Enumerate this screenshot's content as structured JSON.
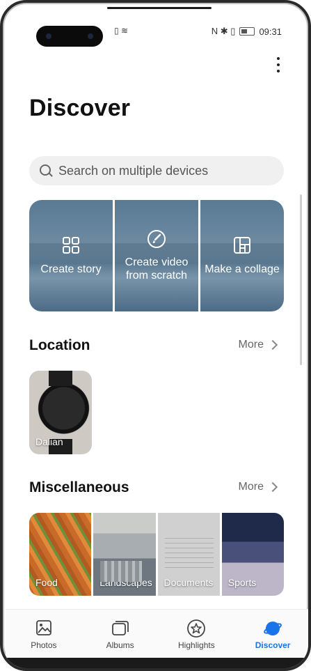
{
  "status": {
    "time": "09:31",
    "left_icons": "▯ ≋",
    "right_icons": "N ✱ ▯"
  },
  "page": {
    "title": "Discover"
  },
  "search": {
    "placeholder": "Search on multiple devices"
  },
  "create": {
    "story": "Create story",
    "video": "Create video from scratch",
    "collage": "Make a collage"
  },
  "location": {
    "title": "Location",
    "more": "More",
    "cards": [
      {
        "label": "Dalian"
      }
    ]
  },
  "misc": {
    "title": "Miscellaneous",
    "more": "More",
    "cards": [
      {
        "label": "Food"
      },
      {
        "label": "Landscapes"
      },
      {
        "label": "Documents"
      },
      {
        "label": "Sports"
      }
    ]
  },
  "nav": {
    "items": [
      {
        "label": "Photos",
        "icon": "photo-icon"
      },
      {
        "label": "Albums",
        "icon": "albums-icon"
      },
      {
        "label": "Highlights",
        "icon": "star-icon"
      },
      {
        "label": "Discover",
        "icon": "planet-icon"
      }
    ],
    "active_color": "#1a73e8"
  }
}
